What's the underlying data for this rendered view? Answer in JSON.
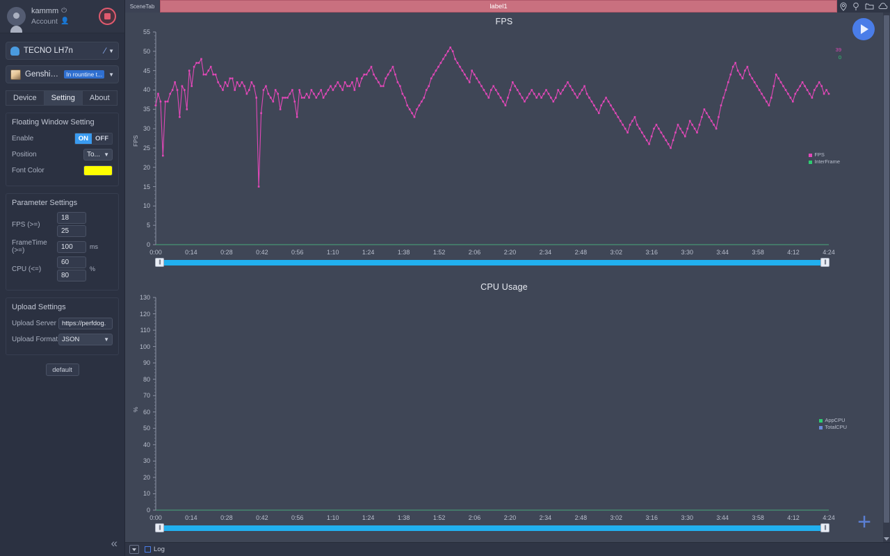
{
  "account": {
    "name": "kammm",
    "sub_label": "Account",
    "power_icon": "power-icon",
    "account_icon": "user-add-icon",
    "record_button": "record-stop-button"
  },
  "device": {
    "name": "TECNO LH7n",
    "icon": "android-icon",
    "link_icon": "usb-link-icon"
  },
  "app": {
    "name": "Genshin Imp...",
    "status_badge": "In rountine t...",
    "icon": "app-icon"
  },
  "tabs": [
    {
      "label": "Device",
      "active": false
    },
    {
      "label": "Setting",
      "active": true
    },
    {
      "label": "About",
      "active": false
    }
  ],
  "floating_window": {
    "title": "Floating Window Setting",
    "enable_label": "Enable",
    "enable_on": "ON",
    "enable_off": "OFF",
    "position_label": "Position",
    "position_value": "To...",
    "font_color_label": "Font Color",
    "font_color_value": "#ffff00"
  },
  "parameters": {
    "title": "Parameter Settings",
    "fps_label": "FPS (>=)",
    "fps_min": "18",
    "fps_max": "25",
    "frametime_label": "FrameTime (>=)",
    "frametime_value": "100",
    "frametime_unit": "ms",
    "cpu_label": "CPU (<=)",
    "cpu_min": "60",
    "cpu_max": "80",
    "cpu_unit": "%"
  },
  "upload": {
    "title": "Upload Settings",
    "server_label": "Upload Server",
    "server_value": "https://perfdog.",
    "format_label": "Upload Format",
    "format_value": "JSON"
  },
  "default_button": "default",
  "collapse_icon": "collapse-left-icon",
  "scene": {
    "tab_label": "SceneTab",
    "label": "label1",
    "icons": [
      "location-pin-icon",
      "marker-pin-icon",
      "folder-icon",
      "cloud-icon"
    ]
  },
  "play_button": "play-button",
  "add_button": "add-button",
  "statusbar": {
    "toggle_icon": "dropdown-icon",
    "log_label": "Log",
    "log_checked": false
  },
  "colors": {
    "fps_series": "#e248b8",
    "interframe_series": "#2ecc71",
    "appcpu_series": "#2ecc71",
    "totalcpu_series": "#6a8ad8",
    "accent": "#4a7de8",
    "slider": "#21b0ef",
    "label_bar": "#c9707f",
    "font_color_swatch": "#ffff00"
  },
  "chart_data": [
    {
      "type": "line",
      "title": "FPS",
      "ylabel": "FPS",
      "xlabel": "",
      "ylim": [
        0,
        55
      ],
      "yticks": [
        0,
        5,
        10,
        15,
        20,
        25,
        30,
        35,
        40,
        45,
        50,
        55
      ],
      "xticks": [
        "0:00",
        "0:14",
        "0:28",
        "0:42",
        "0:56",
        "1:10",
        "1:24",
        "1:38",
        "1:52",
        "2:06",
        "2:20",
        "2:34",
        "2:48",
        "3:02",
        "3:16",
        "3:30",
        "3:44",
        "3:58",
        "4:12",
        "4:24"
      ],
      "grid": false,
      "legend": [
        {
          "name": "FPS",
          "color": "#e248b8"
        },
        {
          "name": "InterFrame",
          "color": "#2ecc71"
        }
      ],
      "current_values": [
        {
          "label": "39",
          "color": "#e248b8"
        },
        {
          "label": "0",
          "color": "#2ecc71"
        }
      ],
      "series": [
        {
          "name": "FPS",
          "color": "#e248b8",
          "values": [
            36,
            39,
            37,
            23,
            37,
            37,
            39,
            40,
            42,
            40,
            33,
            41,
            40,
            35,
            45,
            41,
            46,
            47,
            47,
            48,
            44,
            44,
            45,
            46,
            44,
            44,
            42,
            41,
            40,
            42,
            41,
            43,
            43,
            40,
            42,
            41,
            42,
            41,
            39,
            40,
            42,
            41,
            38,
            15,
            34,
            40,
            41,
            39,
            38,
            37,
            40,
            39,
            35,
            38,
            38,
            38,
            39,
            40,
            37,
            33,
            40,
            38,
            38,
            39,
            38,
            40,
            39,
            38,
            39,
            40,
            38,
            39,
            40,
            41,
            40,
            41,
            42,
            41,
            40,
            42,
            41,
            41,
            42,
            40,
            43,
            41,
            43,
            44,
            44,
            45,
            46,
            44,
            43,
            42,
            41,
            41,
            43,
            44,
            45,
            46,
            44,
            42,
            41,
            39,
            38,
            36,
            35,
            34,
            33,
            35,
            36,
            37,
            38,
            40,
            41,
            43,
            44,
            45,
            46,
            47,
            48,
            49,
            50,
            51,
            50,
            48,
            47,
            46,
            45,
            44,
            43,
            42,
            45,
            44,
            43,
            42,
            41,
            40,
            39,
            38,
            40,
            41,
            40,
            39,
            38,
            37,
            36,
            38,
            40,
            42,
            41,
            40,
            39,
            38,
            37,
            38,
            39,
            40,
            39,
            38,
            39,
            38,
            39,
            40,
            39,
            38,
            37,
            38,
            40,
            39,
            40,
            41,
            42,
            41,
            40,
            39,
            38,
            39,
            40,
            41,
            39,
            38,
            37,
            36,
            35,
            34,
            36,
            37,
            38,
            37,
            36,
            35,
            34,
            33,
            32,
            31,
            30,
            29,
            31,
            32,
            33,
            31,
            30,
            29,
            28,
            27,
            26,
            28,
            30,
            31,
            30,
            29,
            28,
            27,
            26,
            25,
            27,
            29,
            31,
            30,
            29,
            28,
            30,
            32,
            31,
            30,
            29,
            31,
            33,
            35,
            34,
            33,
            32,
            31,
            30,
            33,
            36,
            38,
            40,
            42,
            44,
            46,
            47,
            45,
            44,
            43,
            45,
            46,
            44,
            43,
            42,
            41,
            40,
            39,
            38,
            37,
            36,
            38,
            41,
            44,
            43,
            42,
            41,
            40,
            39,
            38,
            37,
            39,
            40,
            41,
            42,
            41,
            40,
            39,
            38,
            40,
            41,
            42,
            41,
            39,
            40,
            39
          ]
        }
      ],
      "slider": {
        "start_pct": 0,
        "end_pct": 100
      }
    },
    {
      "type": "line",
      "title": "CPU Usage",
      "ylabel": "%",
      "xlabel": "",
      "ylim": [
        0,
        130
      ],
      "yticks": [
        0,
        10,
        20,
        30,
        40,
        50,
        60,
        70,
        80,
        90,
        100,
        110,
        120,
        130
      ],
      "xticks": [
        "0:00",
        "0:14",
        "0:28",
        "0:42",
        "0:56",
        "1:10",
        "1:24",
        "1:38",
        "1:52",
        "2:06",
        "2:20",
        "2:34",
        "2:48",
        "3:02",
        "3:16",
        "3:30",
        "3:44",
        "3:58",
        "4:12",
        "4:24"
      ],
      "grid": false,
      "legend": [
        {
          "name": "AppCPU",
          "color": "#2ecc71"
        },
        {
          "name": "TotalCPU",
          "color": "#6a8ad8"
        }
      ],
      "current_values": [],
      "series": [
        {
          "name": "AppCPU",
          "color": "#2ecc71",
          "values": []
        },
        {
          "name": "TotalCPU",
          "color": "#6a8ad8",
          "values": []
        }
      ],
      "slider": {
        "start_pct": 0,
        "end_pct": 100
      }
    }
  ]
}
